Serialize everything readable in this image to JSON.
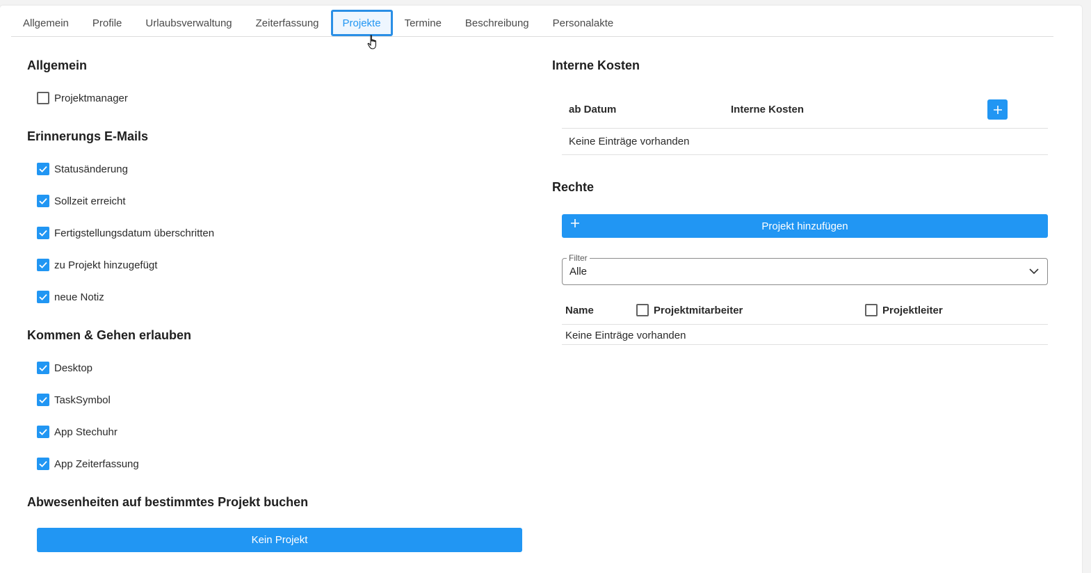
{
  "tabs": [
    {
      "label": "Allgemein"
    },
    {
      "label": "Profile"
    },
    {
      "label": "Urlaubsverwaltung"
    },
    {
      "label": "Zeiterfassung"
    },
    {
      "label": "Projekte"
    },
    {
      "label": "Termine"
    },
    {
      "label": "Beschreibung"
    },
    {
      "label": "Personalakte"
    }
  ],
  "active_tab": "Projekte",
  "left": {
    "allgemein": {
      "title": "Allgemein",
      "items": [
        {
          "label": "Projektmanager",
          "checked": false
        }
      ]
    },
    "emails": {
      "title": "Erinnerungs E-Mails",
      "items": [
        {
          "label": "Statusänderung",
          "checked": true
        },
        {
          "label": "Sollzeit erreicht",
          "checked": true
        },
        {
          "label": "Fertigstellungsdatum überschritten",
          "checked": true
        },
        {
          "label": "zu Projekt hinzugefügt",
          "checked": true
        },
        {
          "label": "neue Notiz",
          "checked": true
        }
      ]
    },
    "kommen": {
      "title": "Kommen & Gehen erlauben",
      "items": [
        {
          "label": "Desktop",
          "checked": true
        },
        {
          "label": "TaskSymbol",
          "checked": true
        },
        {
          "label": "App Stechuhr",
          "checked": true
        },
        {
          "label": "App Zeiterfassung",
          "checked": true
        }
      ]
    },
    "abwesenheiten": {
      "title": "Abwesenheiten auf bestimmtes Projekt buchen",
      "button_label": "Kein Projekt"
    }
  },
  "right": {
    "kosten": {
      "title": "Interne Kosten",
      "col_date": "ab Datum",
      "col_cost": "Interne Kosten",
      "empty": "Keine Einträge vorhanden"
    },
    "rechte": {
      "title": "Rechte",
      "add_label": "Projekt hinzufügen",
      "filter_legend": "Filter",
      "filter_value": "Alle",
      "col_name": "Name",
      "col_mitarbeiter": {
        "label": "Projektmitarbeiter",
        "checked": false
      },
      "col_leiter": {
        "label": "Projektleiter",
        "checked": false
      },
      "empty": "Keine Einträge vorhanden"
    }
  },
  "colors": {
    "accent": "#2196f3",
    "text": "#212121"
  }
}
